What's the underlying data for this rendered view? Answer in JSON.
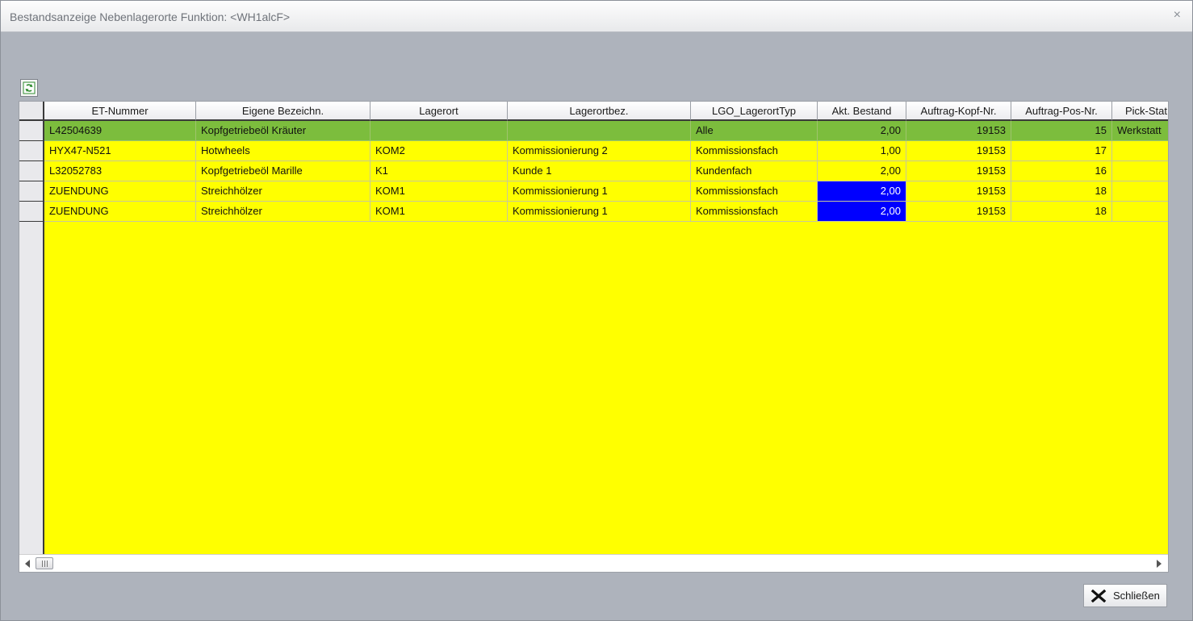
{
  "window": {
    "title": "Bestandsanzeige Nebenlagerorte Funktion: <WH1alcF>",
    "close_glyph": "×"
  },
  "toolbar": {
    "refresh_icon": "refresh-icon"
  },
  "table": {
    "columns": [
      "ET-Nummer",
      "Eigene Bezeichn.",
      "Lagerort",
      "Lagerortbez.",
      "LGO_LagerortTyp",
      "Akt. Bestand",
      "Auftrag-Kopf-Nr.",
      "Auftrag-Pos-Nr.",
      "Pick-Stat"
    ],
    "rows": [
      [
        "L42504639",
        "Kopfgetriebeöl Kräuter",
        "",
        "",
        "Alle",
        "2,00",
        "19153",
        "15",
        "Werkstatt"
      ],
      [
        "HYX47-N521",
        "Hotwheels",
        "KOM2",
        "Kommissionierung 2",
        "Kommissionsfach",
        "1,00",
        "19153",
        "17",
        ""
      ],
      [
        "L32052783",
        "Kopfgetriebeöl Marille",
        "K1",
        "Kunde 1",
        "Kundenfach",
        "2,00",
        "19153",
        "16",
        ""
      ],
      [
        "ZUENDUNG",
        "Streichhölzer",
        "KOM1",
        "Kommissionierung 1",
        "Kommissionsfach",
        "2,00",
        "19153",
        "18",
        ""
      ],
      [
        "ZUENDUNG",
        "Streichhölzer",
        "KOM1",
        "Kommissionierung 1",
        "Kommissionsfach",
        "2,00",
        "19153",
        "18",
        ""
      ]
    ]
  },
  "buttons": {
    "close_label": "Schließen"
  },
  "colors": {
    "highlight_row": "#7cbd3d",
    "row_background": "#ffff00",
    "selected_cell": "#0000ff"
  }
}
